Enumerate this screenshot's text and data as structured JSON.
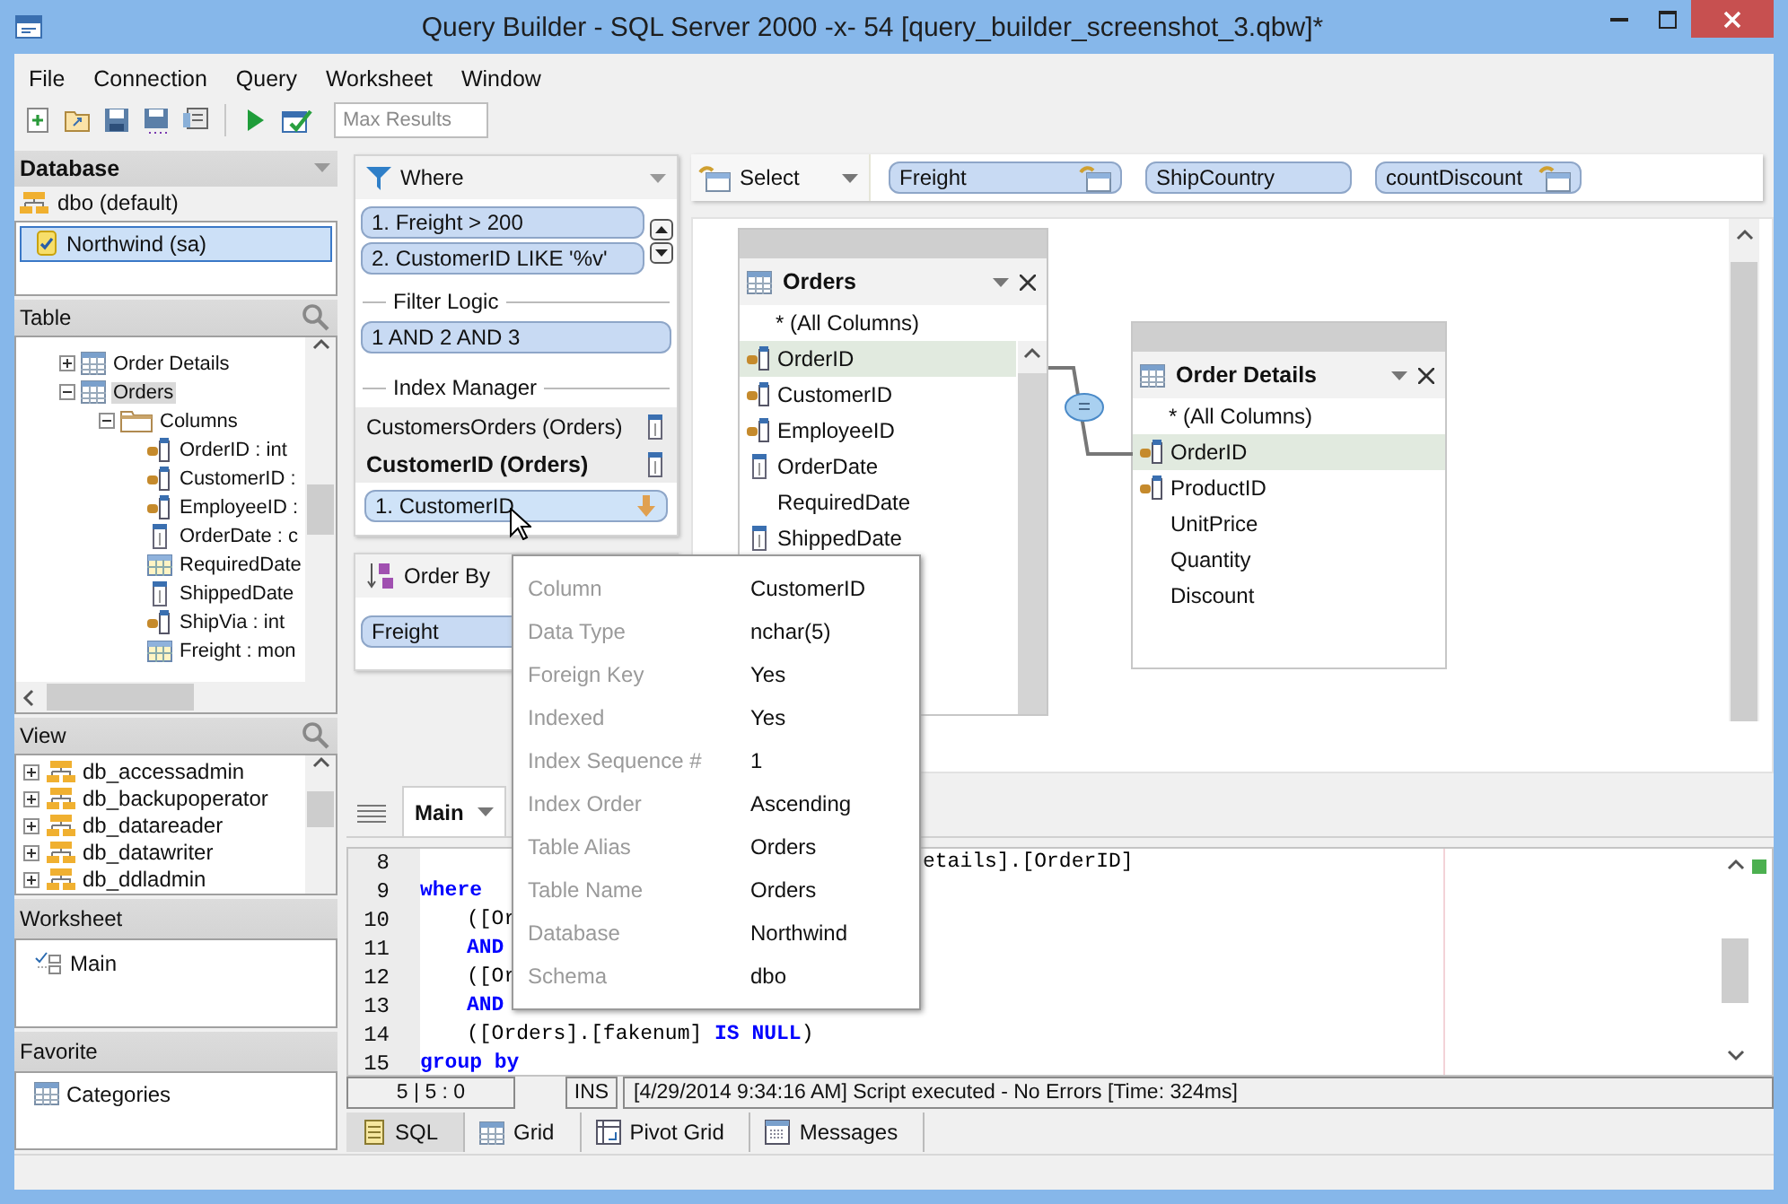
{
  "window": {
    "title": "Query Builder - SQL Server 2000 -x- 54 [query_builder_screenshot_3.qbw]*"
  },
  "menu": [
    "File",
    "Connection",
    "Query",
    "Worksheet",
    "Window"
  ],
  "toolbar": {
    "max_results": {
      "placeholder": "Max Results"
    }
  },
  "database_panel": {
    "title": "Database",
    "schema": "dbo (default)",
    "connections": [
      {
        "label": "Northwind (sa)",
        "selected": true
      }
    ]
  },
  "table_panel": {
    "title": "Table",
    "tree": [
      {
        "label": "Order Details",
        "kind": "table",
        "expanded": false,
        "selected": false
      },
      {
        "label": "Orders",
        "kind": "table",
        "expanded": true,
        "selected": true,
        "children": [
          {
            "label": "Columns",
            "kind": "folder",
            "expanded": true,
            "selected": false,
            "children": [
              {
                "label": "OrderID : int",
                "kind": "key",
                "selected": false
              },
              {
                "label": "CustomerID :",
                "kind": "key",
                "selected": false
              },
              {
                "label": "EmployeeID :",
                "kind": "key",
                "selected": false
              },
              {
                "label": "OrderDate : c",
                "kind": "index",
                "selected": false
              },
              {
                "label": "RequiredDate",
                "kind": "field",
                "selected": false
              },
              {
                "label": "ShippedDate",
                "kind": "index",
                "selected": false
              },
              {
                "label": "ShipVia : int",
                "kind": "key",
                "selected": false
              },
              {
                "label": "Freight : mon",
                "kind": "field",
                "selected": false
              }
            ]
          }
        ]
      }
    ]
  },
  "view_panel": {
    "title": "View",
    "items": [
      "db_accessadmin",
      "db_backupoperator",
      "db_datareader",
      "db_datawriter",
      "db_ddladmin"
    ]
  },
  "worksheet_panel": {
    "title": "Worksheet",
    "items": [
      "Main"
    ]
  },
  "favorite_panel": {
    "title": "Favorite",
    "items": [
      "Categories"
    ]
  },
  "where_panel": {
    "title": "Where",
    "conditions": [
      "1. Freight > 200",
      "2. CustomerID LIKE '%v'"
    ],
    "filter_logic": {
      "label": "Filter Logic",
      "value": "1 AND 2 AND 3"
    },
    "index_manager": {
      "label": "Index Manager",
      "indexes": [
        {
          "label": "CustomersOrders (Orders)",
          "selected": false
        },
        {
          "label": "CustomerID (Orders)",
          "selected": true
        }
      ],
      "index_columns": [
        "1. CustomerID"
      ]
    }
  },
  "order_by_panel": {
    "title": "Order By",
    "fields": [
      "Freight"
    ]
  },
  "select_bar": {
    "label": "Select",
    "fields": [
      {
        "label": "Freight",
        "has_icon": true
      },
      {
        "label": "ShipCountry",
        "has_icon": false
      },
      {
        "label": "countDiscount",
        "has_icon": true
      }
    ]
  },
  "diagram": {
    "tables": [
      {
        "title": "Orders",
        "columns": [
          {
            "label": "* (All Columns)",
            "kind": "all",
            "selected": false
          },
          {
            "label": "OrderID",
            "kind": "key",
            "selected": true
          },
          {
            "label": "CustomerID",
            "kind": "key",
            "selected": false
          },
          {
            "label": "EmployeeID",
            "kind": "key",
            "selected": false
          },
          {
            "label": "OrderDate",
            "kind": "index",
            "selected": false
          },
          {
            "label": "RequiredDate",
            "kind": "plain",
            "selected": false
          },
          {
            "label": "ShippedDate",
            "kind": "index",
            "selected": false
          }
        ]
      },
      {
        "title": "Order Details",
        "columns": [
          {
            "label": "* (All Columns)",
            "kind": "all",
            "selected": false
          },
          {
            "label": "OrderID",
            "kind": "key",
            "selected": true
          },
          {
            "label": "ProductID",
            "kind": "key",
            "selected": false
          },
          {
            "label": "UnitPrice",
            "kind": "plain",
            "selected": false
          },
          {
            "label": "Quantity",
            "kind": "plain",
            "selected": false
          },
          {
            "label": "Discount",
            "kind": "plain",
            "selected": false
          }
        ]
      }
    ]
  },
  "worksheet_tabs": [
    {
      "label": "Main",
      "selected": true
    }
  ],
  "editor": {
    "lines": [
      {
        "number": "8",
        "kind": "tail",
        "tokens": [
          {
            "text": "etails].[OrderID]",
            "kind": "plain"
          }
        ]
      },
      {
        "number": "9",
        "kind": "full",
        "tokens": [
          {
            "text": "where",
            "kind": "keyword"
          }
        ]
      },
      {
        "number": "10",
        "kind": "indented",
        "tokens": [
          {
            "text": "([Or",
            "kind": "plain"
          }
        ]
      },
      {
        "number": "11",
        "kind": "indented",
        "tokens": [
          {
            "text": "AND",
            "kind": "keyword"
          }
        ]
      },
      {
        "number": "12",
        "kind": "indented",
        "tokens": [
          {
            "text": "([Or",
            "kind": "plain"
          }
        ]
      },
      {
        "number": "13",
        "kind": "indented",
        "tokens": [
          {
            "text": "AND",
            "kind": "keyword"
          }
        ]
      },
      {
        "number": "14",
        "kind": "indented",
        "tokens": [
          {
            "text": "([Orders].[fakenum]",
            "kind": "plain"
          },
          {
            "text": "IS NULL",
            "kind": "keyword"
          },
          {
            "text": ")",
            "kind": "plain"
          }
        ]
      },
      {
        "number": "15",
        "kind": "full",
        "tokens": [
          {
            "text": "group by",
            "kind": "keyword"
          }
        ]
      }
    ]
  },
  "status": {
    "position": "5 | 5 : 0",
    "mode": "INS",
    "message": "[4/29/2014 9:34:16 AM] Script executed - No Errors [Time: 324ms]"
  },
  "result_tabs": [
    {
      "label": "SQL",
      "kind": "sql",
      "selected": true
    },
    {
      "label": "Grid",
      "kind": "grid",
      "selected": false
    },
    {
      "label": "Pivot Grid",
      "kind": "pivot",
      "selected": false
    },
    {
      "label": "Messages",
      "kind": "messages",
      "selected": false
    }
  ],
  "tooltip": {
    "rows": [
      {
        "label": "Column",
        "value": "CustomerID"
      },
      {
        "label": "Data Type",
        "value": "nchar(5)"
      },
      {
        "label": "Foreign Key",
        "value": "Yes"
      },
      {
        "label": "Indexed",
        "value": "Yes"
      },
      {
        "label": "Index Sequence #",
        "value": "1"
      },
      {
        "label": "Index Order",
        "value": "Ascending"
      },
      {
        "label": "Table Alias",
        "value": "Orders"
      },
      {
        "label": "Table Name",
        "value": "Orders"
      },
      {
        "label": "Database",
        "value": "Northwind"
      },
      {
        "label": "Schema",
        "value": "dbo"
      }
    ]
  }
}
